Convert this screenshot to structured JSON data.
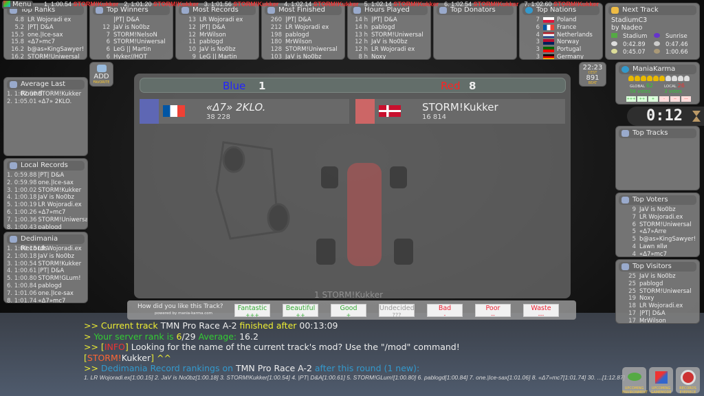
{
  "ticker": [
    {
      "rank": "1. 1:00.54",
      "name": "STORM!Kukker"
    },
    {
      "rank": "2. 1:01.20",
      "name": "STORM!Kukker"
    },
    {
      "rank": "3. 1:01.56",
      "name": "STORM!Kukker"
    },
    {
      "rank": "4. 1:02.14",
      "name": "STORM!Kukker"
    },
    {
      "rank": "5. 1:02.14",
      "name": "STORM!Kukker"
    },
    {
      "rank": "6. 1:02.54",
      "name": "STORM!Kukker"
    },
    {
      "rank": "7. 1:02.60",
      "name": "STORM!Kukker"
    }
  ],
  "menu_label": "Menu",
  "top_ranks": {
    "title": "Top Ranks",
    "rows": [
      [
        "4.8",
        "LR Wojoradi ex"
      ],
      [
        "5.2",
        "|PT| D&A"
      ],
      [
        "15.5",
        "one.|Ice-sax"
      ],
      [
        "15.8",
        "«Δ7»mc7"
      ],
      [
        "16.2",
        "b@as»KingSawyer!"
      ],
      [
        "16.2",
        "STORM!Uniwersal"
      ]
    ]
  },
  "top_winners": {
    "title": "Top Winners",
    "rows": [
      [
        "",
        "|PT| D&A"
      ],
      [
        "12",
        "JaV is No0bz"
      ],
      [
        "7",
        "STORM!NelsoN"
      ],
      [
        "6",
        "STORM!Uniwersal"
      ],
      [
        "6",
        "LeG || Martin"
      ],
      [
        "6",
        "Hyker//HOT"
      ]
    ]
  },
  "most_records": {
    "title": "Most Records",
    "rows": [
      [
        "13",
        "LR Wojoradi ex"
      ],
      [
        "12",
        "|PT| D&A"
      ],
      [
        "12",
        "MrWilson"
      ],
      [
        "11",
        "pablogd"
      ],
      [
        "10",
        "JaV is No0bz"
      ],
      [
        "9",
        "LeG || Martin"
      ]
    ]
  },
  "most_finished": {
    "title": "Most Finished",
    "rows": [
      [
        "260",
        "|PT| D&A"
      ],
      [
        "212",
        "LR Wojoradi ex"
      ],
      [
        "198",
        "pablogd"
      ],
      [
        "180",
        "MrWilson"
      ],
      [
        "128",
        "STORM!Uniwersal"
      ],
      [
        "103",
        "JaV is No0bz"
      ]
    ]
  },
  "hours_played": {
    "title": "Hours Played",
    "rows": [
      [
        "14 h",
        "|PT| D&A"
      ],
      [
        "14 h",
        "pablogd"
      ],
      [
        "13 h",
        "STORM!Uniwersal"
      ],
      [
        "12 h",
        "JaV is No0bz"
      ],
      [
        "12 h",
        "LR Wojoradi ex"
      ],
      [
        "8 h",
        "Noxy"
      ]
    ]
  },
  "top_donators": {
    "title": "Top Donators",
    "rows": []
  },
  "top_nations": {
    "title": "Top Nations",
    "rows": [
      {
        "count": "7",
        "country": "Poland",
        "colors": [
          "#ffffff",
          "#dc143c"
        ]
      },
      {
        "count": "6",
        "country": "France",
        "colors": [
          "#0055a4",
          "#ffffff",
          "#ef4135"
        ]
      },
      {
        "count": "4",
        "country": "Netherlands",
        "colors": [
          "#ae1c28",
          "#ffffff",
          "#21468b"
        ]
      },
      {
        "count": "3",
        "country": "Norway",
        "colors": [
          "#ba0c2f",
          "#00205b"
        ]
      },
      {
        "count": "3",
        "country": "Portugal",
        "colors": [
          "#006600",
          "#ff0000"
        ]
      },
      {
        "count": "3",
        "country": "Germany",
        "colors": [
          "#000000",
          "#dd0000",
          "#ffce00"
        ]
      }
    ]
  },
  "next_track": {
    "title": "Next Track",
    "name": "StadiumC3",
    "author": "by Nadeo",
    "environment": "Stadium",
    "mood": "Sunrise",
    "author_time": "0:42.89",
    "gold_time": "0:47.46",
    "silver_time": "0:45.07",
    "bronze_time": "1:00.66"
  },
  "add_favorite": {
    "main": "ADD",
    "sub": "FAVORITE"
  },
  "average_last_round": {
    "title": "Average Last Round",
    "rows": [
      [
        "1. 1:02.60",
        "STORM!Kukker"
      ],
      [
        "2. 1:05.01",
        "«Δ7» 2KLO."
      ]
    ]
  },
  "local_records": {
    "title": "Local Records",
    "rows": [
      [
        "1. 0:59.88",
        "|PT| D&A"
      ],
      [
        "2. 0:59.98",
        "one.|Ice-sax"
      ],
      [
        "3. 1:00.02",
        "STORM!Kukker"
      ],
      [
        "4. 1:00.18",
        "JaV is No0bz"
      ],
      [
        "5. 1:00.19",
        "LR Wojoradi.ex"
      ],
      [
        "6. 1:00.26",
        "«Δ7»mc7"
      ],
      [
        "7. 1:00.36",
        "STORM!Uniwersal"
      ],
      [
        "8. 1:00.43",
        "pablogd"
      ]
    ]
  },
  "dedimania_records": {
    "title": "Dedimania Records",
    "rows": [
      [
        "1. 1:00.15",
        "LR Wojoradi.ex"
      ],
      [
        "2. 1:00.18",
        "JaV is No0bz"
      ],
      [
        "3. 1:00.54",
        "STORM!Kukker"
      ],
      [
        "4. 1:00.61",
        "|PT| D&A"
      ],
      [
        "5. 1:00.80",
        "STORM!GLum!"
      ],
      [
        "6. 1:00.84",
        "pablogd"
      ],
      [
        "7. 1:01.06",
        "one.|Ice-sax"
      ],
      [
        "8. 1:01.74",
        "«Δ7»mc7"
      ]
    ]
  },
  "clock": {
    "time": "22:23",
    "zone": "CEST",
    "beat": "891",
    "beat_label": "BEAT"
  },
  "mania_karma": {
    "title": "ManiaKarma",
    "rating_fraction": 0.6,
    "global_label": "GLOBAL",
    "global_value": "62",
    "global_votes": "58 votes",
    "local_label": "LOCAL",
    "local_value": "26",
    "local_votes": "3 votes",
    "buttons": [
      "+++",
      "++",
      "+",
      "-",
      "--",
      "---"
    ]
  },
  "timer": "0:12",
  "top_tracks": {
    "title": "Top Tracks",
    "rows": []
  },
  "top_voters": {
    "title": "Top Voters",
    "rows": [
      [
        "9",
        "JaV is No0bz"
      ],
      [
        "7",
        "LR Wojoradi.ex"
      ],
      [
        "6",
        "STORM!Uniwersal"
      ],
      [
        "5",
        "«Δ7»Arre"
      ],
      [
        "5",
        "b@as»KingSawyer!"
      ],
      [
        "4",
        "Lawn яllи"
      ],
      [
        "4",
        "«Δ7»mc7"
      ]
    ]
  },
  "top_visitors": {
    "title": "Top Visitors",
    "rows": [
      [
        "25",
        "JaV is No0bz"
      ],
      [
        "25",
        "pablogd"
      ],
      [
        "25",
        "STORM!Uniwersal"
      ],
      [
        "19",
        "Noxy"
      ],
      [
        "18",
        "LR Wojoradi.ex"
      ],
      [
        "17",
        "|PT| D&A"
      ],
      [
        "17",
        "MrWilson"
      ]
    ]
  },
  "scoreboard": {
    "blue_label": "Blue",
    "blue_score": "1",
    "red_label": "Red",
    "red_score": "8",
    "blue_player": {
      "name": "«Δ7» 2KLO.",
      "points": "38 228"
    },
    "red_player": {
      "name": "STORM!Kukker",
      "points": "16 814"
    },
    "watermark": "1 STORM!Kukker"
  },
  "vote": {
    "question": "How did you like this Track?",
    "powered": "powered by mania-karma.com",
    "buttons": [
      {
        "label": "Fantastic",
        "sub": "+++",
        "color": "#3a3"
      },
      {
        "label": "Beautiful",
        "sub": "++",
        "color": "#3a3"
      },
      {
        "label": "Good",
        "sub": "+",
        "color": "#3a3"
      },
      {
        "label": "Undecided",
        "sub": "???",
        "color": "#999"
      },
      {
        "label": "Bad",
        "sub": "-",
        "color": "#e23"
      },
      {
        "label": "Poor",
        "sub": "--",
        "color": "#e23"
      },
      {
        "label": "Waste",
        "sub": "---",
        "color": "#e23"
      }
    ]
  },
  "chat": [
    [
      {
        "t": ">> Current track ",
        "c": "#ee3"
      },
      {
        "t": "TMN Pro Race A-2",
        "c": "#eee"
      },
      {
        "t": " finished after ",
        "c": "#ee3"
      },
      {
        "t": "00:13:09",
        "c": "#eee"
      }
    ],
    [
      {
        "t": "> ",
        "c": "#ee3"
      },
      {
        "t": "Your server rank is ",
        "c": "#3c3"
      },
      {
        "t": "6",
        "c": "#ee3"
      },
      {
        "t": "/29 ",
        "c": "#eee"
      },
      {
        "t": "Average: ",
        "c": "#3c3"
      },
      {
        "t": "16.2",
        "c": "#eee"
      }
    ],
    [
      {
        "t": ">> [",
        "c": "#ee3"
      },
      {
        "t": "INFO",
        "c": "#e33"
      },
      {
        "t": "] ",
        "c": "#ee3"
      },
      {
        "t": "Looking for the name of the current track's mod?  Use the \"/mod\" command!",
        "c": "#eee"
      }
    ],
    [
      {
        "t": "[",
        "c": "#ee3"
      },
      {
        "t": "STORM!",
        "c": "#f63"
      },
      {
        "t": "Kukker",
        "c": "#eee"
      },
      {
        "t": "] ^^",
        "c": "#ee3"
      }
    ],
    [
      {
        "t": ">> ",
        "c": "#ee3"
      },
      {
        "t": "Dedimania Record rankings on ",
        "c": "#39c"
      },
      {
        "t": "TMN Pro Race A-2",
        "c": "#eee"
      },
      {
        "t": " after this round (1 new):",
        "c": "#39c"
      }
    ]
  ],
  "dedi_line": "1. LR Wojoradi.ex[1:00.15] 2. JaV is No0bz[1:00.18] 3. STORM!Kukker[1:00.54] 4. |PT| D&A[1:00.61] 5. STORM!GLum![1:00.80] 6. pablogd[1:00.84] 7. one.|Ice-sax[1:01.06] 8. «Δ7»mc7[1:01.74] 30. ...[1:12.87]",
  "bottom_buttons": [
    {
      "label": "UPCOMING ENVIRONMENT"
    },
    {
      "label": "UPCOMING GAMEMODE"
    },
    {
      "label": "RECORDS EYEPIECE"
    }
  ]
}
